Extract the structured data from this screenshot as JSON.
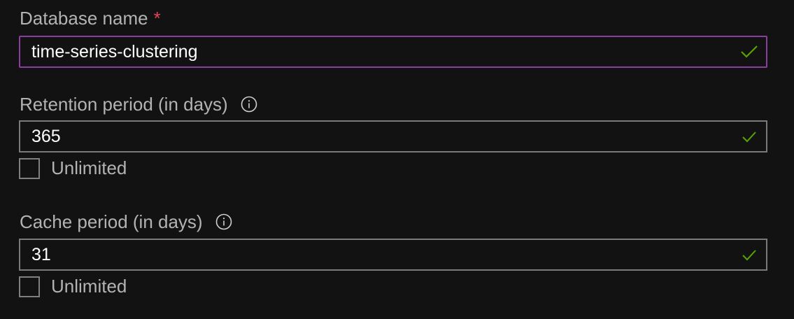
{
  "database_name": {
    "label": "Database name",
    "required_marker": "*",
    "value": "time-series-clustering",
    "valid_icon": "checkmark-icon"
  },
  "retention_period": {
    "label": "Retention period (in days)",
    "info_icon": "info-icon",
    "value": "365",
    "valid_icon": "checkmark-icon",
    "unlimited_label": "Unlimited",
    "unlimited_checked": false
  },
  "cache_period": {
    "label": "Cache period (in days)",
    "info_icon": "info-icon",
    "value": "31",
    "valid_icon": "checkmark-icon",
    "unlimited_label": "Unlimited",
    "unlimited_checked": false
  },
  "colors": {
    "background": "#121213",
    "label_text": "#b3b3b3",
    "input_text": "#ffffff",
    "required": "#e8435a",
    "focus_border": "#8c3ea0",
    "border": "#7a7a7a",
    "valid_check": "#57a300"
  }
}
